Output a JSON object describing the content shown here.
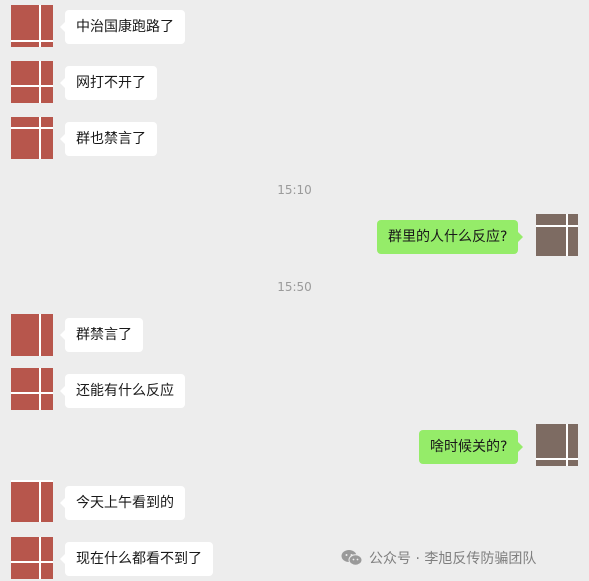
{
  "chat": {
    "colors": {
      "background": "#ededed",
      "incoming_bubble": "#ffffff",
      "outgoing_bubble": "#95ec69",
      "contact_avatar": "#b7564c",
      "self_avatar": "#7d6b62",
      "timestamp_text": "#9b9b9b"
    },
    "messages": [
      {
        "text": "中治国康跑路了"
      },
      {
        "text": "网打不开了"
      },
      {
        "text": "群也禁言了"
      },
      {
        "text": "群里的人什么反应?"
      },
      {
        "text": "群禁言了"
      },
      {
        "text": "还能有什么反应"
      },
      {
        "text": "啥时候关的?"
      },
      {
        "text": "今天上午看到的"
      },
      {
        "text": "现在什么都看不到了"
      }
    ],
    "timestamps": [
      "15:10",
      "15:50"
    ]
  },
  "watermark": {
    "text": "公众号 · 李旭反传防骗团队",
    "icon": "wechat-icon"
  }
}
